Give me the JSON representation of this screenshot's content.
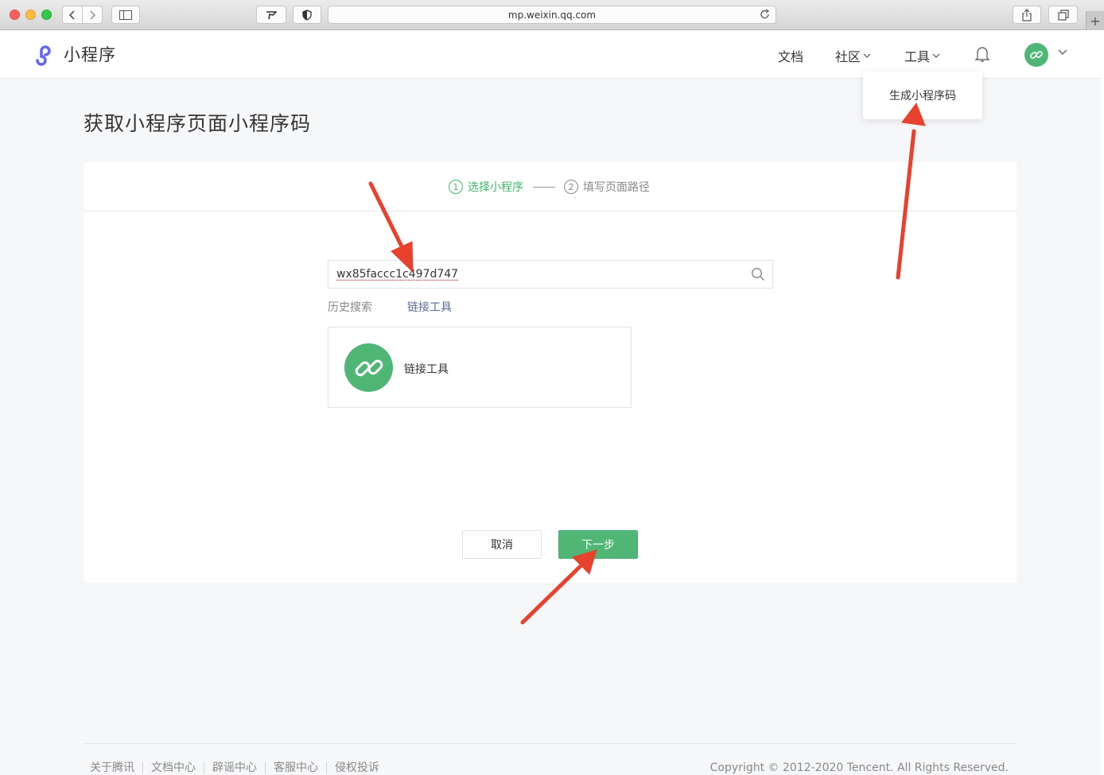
{
  "browser": {
    "url": "mp.weixin.qq.com",
    "new_tab_symbol": "+"
  },
  "header": {
    "logo_text": "小程序",
    "nav": {
      "docs": "文档",
      "community": "社区",
      "tools": "工具"
    },
    "tools_menu": [
      "生成小程序码"
    ]
  },
  "main": {
    "title": "获取小程序页面小程序码",
    "steps": [
      {
        "num": "1",
        "label": "选择小程序",
        "active": true
      },
      {
        "num": "2",
        "label": "填写页面路径",
        "active": false
      }
    ],
    "search": {
      "value": "wx85faccc1c497d747"
    },
    "history": {
      "label": "历史搜索",
      "items": [
        "链接工具"
      ]
    },
    "result": {
      "name": "链接工具"
    },
    "buttons": {
      "cancel": "取消",
      "next": "下一步"
    }
  },
  "footer": {
    "links": [
      "关于腾讯",
      "文档中心",
      "辟谣中心",
      "客服中心",
      "侵权投诉"
    ],
    "copyright": "Copyright © 2012-2020 Tencent. All Rights Reserved."
  },
  "colors": {
    "brand_green": "#4fb675",
    "link_blue": "#576b95",
    "annotation_red": "#e8412d"
  }
}
